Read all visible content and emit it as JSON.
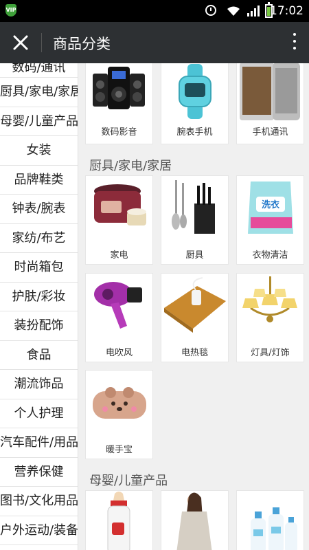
{
  "status_bar": {
    "time": "17:02",
    "badge": "VIP"
  },
  "header": {
    "title": "商品分类",
    "close_icon": "close-icon",
    "more_icon": "more-vert-icon"
  },
  "sidebar": {
    "items": [
      {
        "label": "数码/通讯"
      },
      {
        "label": "厨具/家电/家居"
      },
      {
        "label": "母婴/儿童产品"
      },
      {
        "label": "女装"
      },
      {
        "label": "品牌鞋类"
      },
      {
        "label": "钟表/腕表"
      },
      {
        "label": "家纺/布艺"
      },
      {
        "label": "时尚箱包"
      },
      {
        "label": "护肤/彩妆"
      },
      {
        "label": "装扮配饰"
      },
      {
        "label": "食品"
      },
      {
        "label": "潮流饰品"
      },
      {
        "label": "个人护理"
      },
      {
        "label": "汽车配件/用品"
      },
      {
        "label": "营养保健"
      },
      {
        "label": "图书/文化用品"
      },
      {
        "label": "户外运动/装备"
      }
    ]
  },
  "sections": [
    {
      "title": "",
      "items": [
        {
          "label": "数码影音",
          "icon": "speaker-icon"
        },
        {
          "label": "腕表手机",
          "icon": "watch-phone-icon"
        },
        {
          "label": "手机通讯",
          "icon": "smartphone-icon"
        }
      ]
    },
    {
      "title": "厨具/家电/家居",
      "items": [
        {
          "label": "家电",
          "icon": "rice-cooker-icon"
        },
        {
          "label": "厨具",
          "icon": "knife-set-icon"
        },
        {
          "label": "衣物清洁",
          "icon": "detergent-icon"
        },
        {
          "label": "电吹风",
          "icon": "hair-dryer-icon"
        },
        {
          "label": "电热毯",
          "icon": "electric-blanket-icon"
        },
        {
          "label": "灯具/灯饰",
          "icon": "chandelier-icon"
        },
        {
          "label": "暖手宝",
          "icon": "hand-warmer-icon"
        }
      ]
    },
    {
      "title": "母婴/儿童产品",
      "items": [
        {
          "label": "",
          "icon": "baby-bottle-icon"
        },
        {
          "label": "",
          "icon": "maternity-coat-icon"
        },
        {
          "label": "",
          "icon": "baby-wash-icon"
        }
      ]
    }
  ],
  "detergent_brand": "洗衣"
}
